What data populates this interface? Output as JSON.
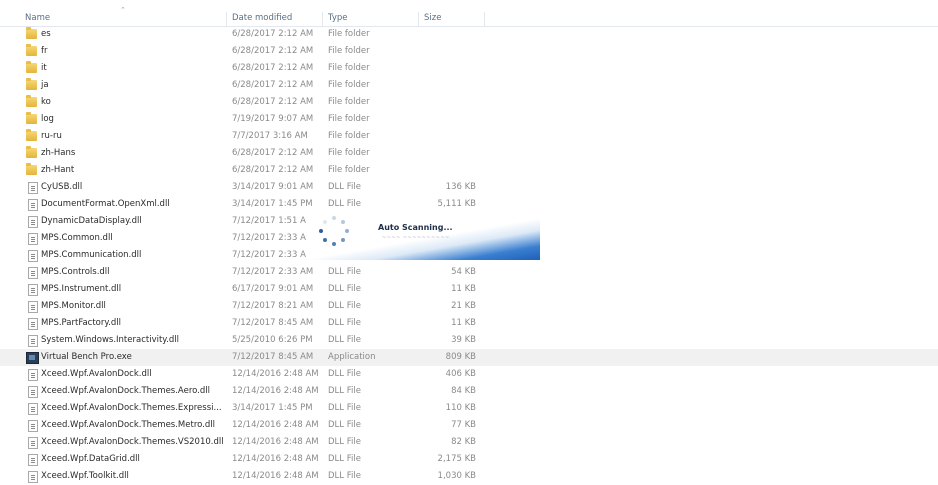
{
  "columns": {
    "name": "Name",
    "date_modified": "Date modified",
    "type": "Type",
    "size": "Size"
  },
  "files": [
    {
      "name": "es",
      "date": "6/28/2017 2:12 AM",
      "type": "File folder",
      "size": "",
      "icon": "folder-icon"
    },
    {
      "name": "fr",
      "date": "6/28/2017 2:12 AM",
      "type": "File folder",
      "size": "",
      "icon": "folder-icon"
    },
    {
      "name": "it",
      "date": "6/28/2017 2:12 AM",
      "type": "File folder",
      "size": "",
      "icon": "folder-icon"
    },
    {
      "name": "ja",
      "date": "6/28/2017 2:12 AM",
      "type": "File folder",
      "size": "",
      "icon": "folder-icon"
    },
    {
      "name": "ko",
      "date": "6/28/2017 2:12 AM",
      "type": "File folder",
      "size": "",
      "icon": "folder-icon"
    },
    {
      "name": "log",
      "date": "7/19/2017 9:07 AM",
      "type": "File folder",
      "size": "",
      "icon": "folder-icon"
    },
    {
      "name": "ru-ru",
      "date": "7/7/2017 3:16 AM",
      "type": "File folder",
      "size": "",
      "icon": "folder-icon"
    },
    {
      "name": "zh-Hans",
      "date": "6/28/2017 2:12 AM",
      "type": "File folder",
      "size": "",
      "icon": "folder-icon"
    },
    {
      "name": "zh-Hant",
      "date": "6/28/2017 2:12 AM",
      "type": "File folder",
      "size": "",
      "icon": "folder-icon"
    },
    {
      "name": "CyUSB.dll",
      "date": "3/14/2017 9:01 AM",
      "type": "DLL File",
      "size": "136 KB",
      "icon": "dll-file-icon"
    },
    {
      "name": "DocumentFormat.OpenXml.dll",
      "date": "3/14/2017 1:45 PM",
      "type": "DLL File",
      "size": "5,111 KB",
      "icon": "dll-file-icon"
    },
    {
      "name": "DynamicDataDisplay.dll",
      "date": "7/12/2017 1:51 A",
      "type": "",
      "size": "",
      "icon": "dll-file-icon"
    },
    {
      "name": "MPS.Common.dll",
      "date": "7/12/2017 2:33 A",
      "type": "",
      "size": "",
      "icon": "dll-file-icon"
    },
    {
      "name": "MPS.Communication.dll",
      "date": "7/12/2017 2:33 A",
      "type": "",
      "size": "",
      "icon": "dll-file-icon"
    },
    {
      "name": "MPS.Controls.dll",
      "date": "7/12/2017 2:33 AM",
      "type": "DLL File",
      "size": "54 KB",
      "icon": "dll-file-icon"
    },
    {
      "name": "MPS.Instrument.dll",
      "date": "6/17/2017 9:01 AM",
      "type": "DLL File",
      "size": "11 KB",
      "icon": "dll-file-icon"
    },
    {
      "name": "MPS.Monitor.dll",
      "date": "7/12/2017 8:21 AM",
      "type": "DLL File",
      "size": "21 KB",
      "icon": "dll-file-icon"
    },
    {
      "name": "MPS.PartFactory.dll",
      "date": "7/12/2017 8:45 AM",
      "type": "DLL File",
      "size": "11 KB",
      "icon": "dll-file-icon"
    },
    {
      "name": "System.Windows.Interactivity.dll",
      "date": "5/25/2010 6:26 PM",
      "type": "DLL File",
      "size": "39 KB",
      "icon": "dll-file-icon"
    },
    {
      "name": "Virtual Bench Pro.exe",
      "date": "7/12/2017 8:45 AM",
      "type": "Application",
      "size": "809 KB",
      "icon": "application-icon",
      "selected": true
    },
    {
      "name": "Xceed.Wpf.AvalonDock.dll",
      "date": "12/14/2016 2:48 AM",
      "type": "DLL File",
      "size": "406 KB",
      "icon": "dll-file-icon"
    },
    {
      "name": "Xceed.Wpf.AvalonDock.Themes.Aero.dll",
      "date": "12/14/2016 2:48 AM",
      "type": "DLL File",
      "size": "84 KB",
      "icon": "dll-file-icon"
    },
    {
      "name": "Xceed.Wpf.AvalonDock.Themes.Expressi...",
      "date": "3/14/2017 1:45 PM",
      "type": "DLL File",
      "size": "110 KB",
      "icon": "dll-file-icon"
    },
    {
      "name": "Xceed.Wpf.AvalonDock.Themes.Metro.dll",
      "date": "12/14/2016 2:48 AM",
      "type": "DLL File",
      "size": "77 KB",
      "icon": "dll-file-icon"
    },
    {
      "name": "Xceed.Wpf.AvalonDock.Themes.VS2010.dll",
      "date": "12/14/2016 2:48 AM",
      "type": "DLL File",
      "size": "82 KB",
      "icon": "dll-file-icon"
    },
    {
      "name": "Xceed.Wpf.DataGrid.dll",
      "date": "12/14/2016 2:48 AM",
      "type": "DLL File",
      "size": "2,175 KB",
      "icon": "dll-file-icon"
    },
    {
      "name": "Xceed.Wpf.Toolkit.dll",
      "date": "12/14/2016 2:48 AM",
      "type": "DLL File",
      "size": "1,030 KB",
      "icon": "dll-file-icon"
    }
  ],
  "overlay": {
    "title": "Auto Scanning...",
    "subtitle": "~~~~ ~~~~~~~~~~"
  },
  "colors": {
    "selected_row": "#f1f1f1",
    "header_text": "#5a6f84",
    "overlay_accent": "#1f5fb8"
  }
}
